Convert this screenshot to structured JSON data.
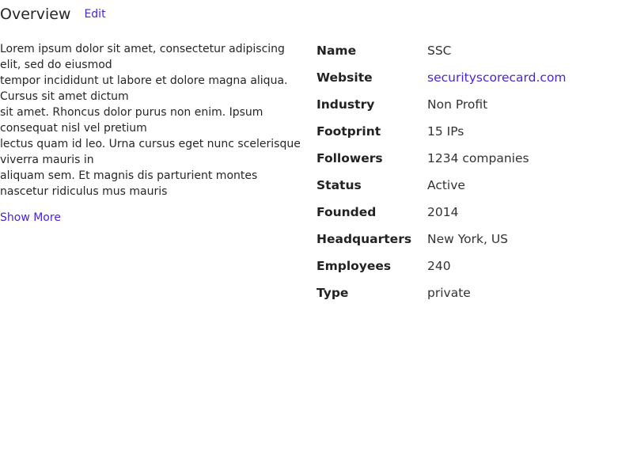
{
  "header": {
    "title": "Overview",
    "edit_label": "Edit"
  },
  "description": {
    "lines": [
      "Lorem ipsum dolor sit amet, consectetur adipiscing elit, sed do eiusmod",
      "tempor incididunt ut labore et dolore magna aliqua. Cursus sit amet dictum",
      "sit amet. Rhoncus dolor purus non enim. Ipsum consequat nisl vel pretium",
      "lectus quam id leo. Urna cursus eget nunc scelerisque viverra mauris in",
      "aliquam sem. Et magnis dis parturient montes nascetur ridiculus mus mauris"
    ],
    "show_more_label": "Show More"
  },
  "details": [
    {
      "label": "Name",
      "value": "SSC"
    },
    {
      "label": "Website",
      "value": "securityscorecard.com"
    },
    {
      "label": "Industry",
      "value": "Non Profit"
    },
    {
      "label": "Footprint",
      "value": "15 IPs"
    },
    {
      "label": "Followers",
      "value": "1234 companies"
    },
    {
      "label": "Status",
      "value": "Active"
    },
    {
      "label": "Founded",
      "value": "2014"
    },
    {
      "label": "Headquarters",
      "value": "New York, US"
    },
    {
      "label": "Employees",
      "value": "240"
    },
    {
      "label": "Type",
      "value": "private"
    }
  ],
  "colors": {
    "accent": "#4a26c9",
    "text": "#222222"
  }
}
